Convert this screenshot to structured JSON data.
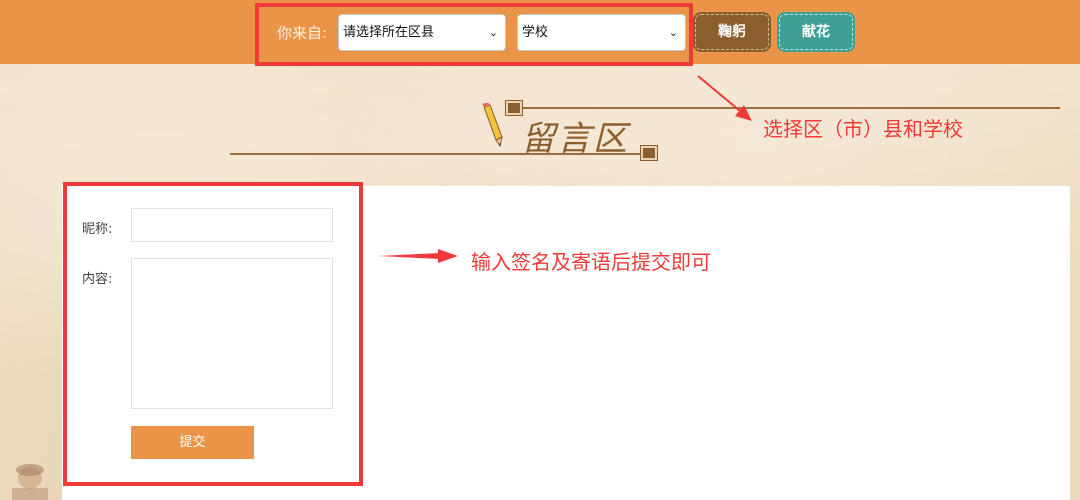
{
  "header": {
    "from_label": "你来自:",
    "district_select": {
      "selected": "请选择所在区县"
    },
    "school_select": {
      "selected": "学校"
    },
    "bow_button": "鞠躬",
    "flower_button": "献花"
  },
  "section": {
    "title": "留言区"
  },
  "form": {
    "nickname_label": "昵称:",
    "nickname_value": "",
    "content_label": "内容:",
    "content_value": "",
    "submit_button": "提交"
  },
  "annotations": {
    "select_hint": "选择区（市）县和学校",
    "submit_hint": "输入签名及寄语后提交即可"
  },
  "colors": {
    "topbar": "#ea9448",
    "bow_button": "#8b5e2e",
    "flower_button": "#3e9f95",
    "annotation": "#f03a3a"
  }
}
